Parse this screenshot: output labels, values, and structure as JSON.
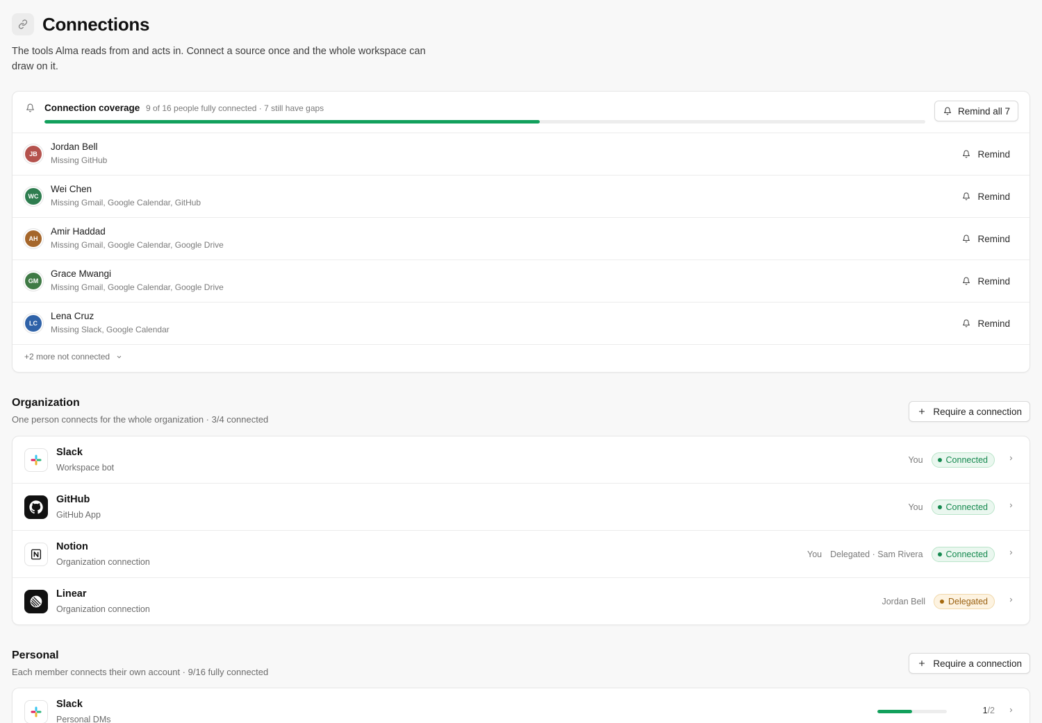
{
  "header": {
    "title": "Connections",
    "icon": "link-icon",
    "description": "The tools Alma reads from and acts in. Connect a source once and the whole workspace can draw on it."
  },
  "coverage": {
    "title": "Connection coverage",
    "summary": "9 of 16 people fully connected · 7 still have gaps",
    "connected": 9,
    "total": 16,
    "remind_all_label": "Remind all 7",
    "accent": "#12a05c",
    "people": [
      {
        "initials": "JB",
        "name": "Jordan Bell",
        "missing": "Missing GitHub",
        "color": "#b4524d",
        "remind_label": "Remind"
      },
      {
        "initials": "WC",
        "name": "Wei Chen",
        "missing": "Missing Gmail, Google Calendar, GitHub",
        "color": "#2e7d4f",
        "remind_label": "Remind"
      },
      {
        "initials": "AH",
        "name": "Amir Haddad",
        "missing": "Missing Gmail, Google Calendar, Google Drive",
        "color": "#a5662a",
        "remind_label": "Remind"
      },
      {
        "initials": "GM",
        "name": "Grace Mwangi",
        "missing": "Missing Gmail, Google Calendar, Google Drive",
        "color": "#3f7a45",
        "remind_label": "Remind"
      },
      {
        "initials": "LC",
        "name": "Lena Cruz",
        "missing": "Missing Slack, Google Calendar",
        "color": "#2f62a8",
        "remind_label": "Remind"
      }
    ],
    "more_label": "+2 more not connected"
  },
  "organization": {
    "title": "Organization",
    "subtitle": "One person connects for the whole organization · 3/4 connected",
    "require_label": "Require a connection",
    "items": [
      {
        "name": "Slack",
        "sub": "Workspace bot",
        "icon": "slack-icon",
        "owner": "You",
        "delegate": "",
        "status": "Connected",
        "status_color": "#15894f"
      },
      {
        "name": "GitHub",
        "sub": "GitHub App",
        "icon": "github-icon",
        "owner": "You",
        "delegate": "",
        "status": "Connected",
        "status_color": "#15894f"
      },
      {
        "name": "Notion",
        "sub": "Organization connection",
        "icon": "notion-icon",
        "owner": "You",
        "delegate": "Delegated · Sam Rivera",
        "status": "Connected",
        "status_color": "#15894f"
      },
      {
        "name": "Linear",
        "sub": "Organization connection",
        "icon": "linear-icon",
        "owner": "Jordan Bell",
        "delegate": "",
        "status": "Delegated",
        "status_color": "#9a6010"
      }
    ]
  },
  "personal": {
    "title": "Personal",
    "subtitle": "Each member connects their own account · 9/16 fully connected",
    "require_label": "Require a connection",
    "items": [
      {
        "name": "Slack",
        "sub": "Personal DMs",
        "icon": "slack-icon",
        "connected": "1",
        "total": "/2",
        "progress": 0.5
      }
    ]
  }
}
